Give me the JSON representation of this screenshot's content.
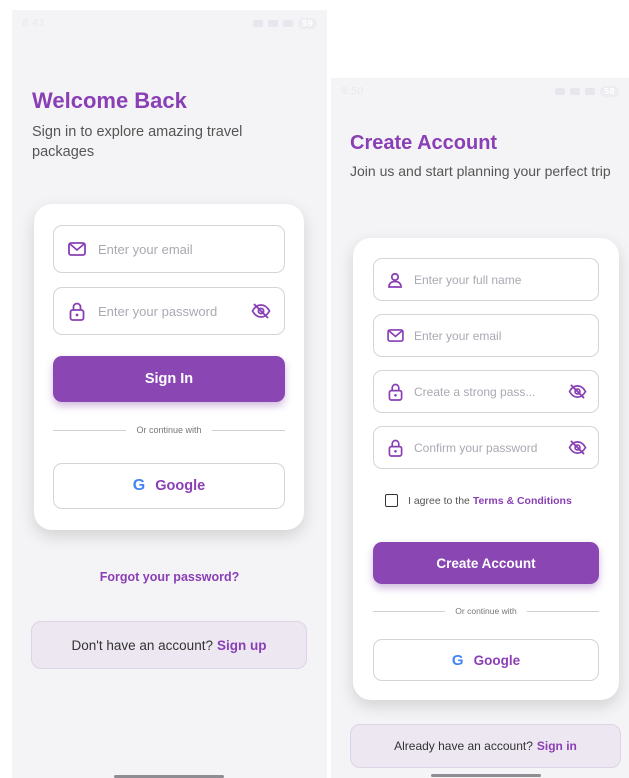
{
  "signin": {
    "status": {
      "time": "8:43",
      "battery": "59"
    },
    "title": "Welcome Back",
    "subtitle": "Sign in to explore amazing travel packages",
    "email_placeholder": "Enter your email",
    "password_placeholder": "Enter your password",
    "signin_button": "Sign In",
    "divider": "Or continue with",
    "google_button": "Google",
    "forgot_link": "Forgot your password?",
    "no_account_text": "Don't have an account?",
    "signup_link": "Sign up"
  },
  "signup": {
    "status": {
      "time": "8:50",
      "battery": "58"
    },
    "title": "Create Account",
    "subtitle": "Join us and start planning your perfect trip",
    "fullname_placeholder": "Enter your full name",
    "email_placeholder": "Enter your email",
    "password_placeholder": "Create a strong pass...",
    "confirm_placeholder": "Confirm your password",
    "agree_text": "I agree to the",
    "terms_link": "Terms & Conditions",
    "create_button": "Create Account",
    "divider": "Or continue with",
    "google_button": "Google",
    "have_account_text": "Already have an account?",
    "signin_link": "Sign in"
  },
  "icons": {
    "email": "mail-icon",
    "password": "lock-icon",
    "visibility": "eye-off-icon",
    "name": "person-icon",
    "google": "google-logo-icon"
  },
  "colors": {
    "accent": "#8a47b4",
    "title": "#8a3fb5",
    "background": "#f4f4f6"
  }
}
